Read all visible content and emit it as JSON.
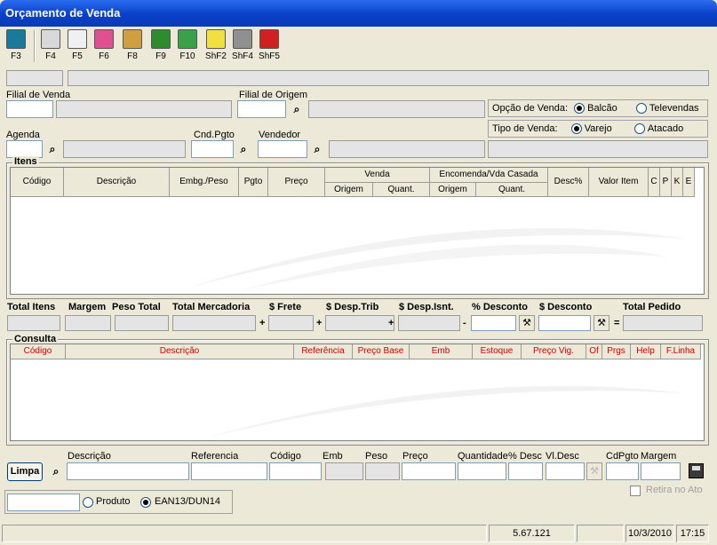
{
  "window": {
    "title": "Orçamento de Venda"
  },
  "toolbar": [
    {
      "key": "F3",
      "icon": "door-exit-icon",
      "color": "#1a7a9a"
    },
    {
      "key": "F4",
      "icon": "notepad-icon",
      "color": "#d8d8d8"
    },
    {
      "key": "F5",
      "icon": "documents-icon",
      "color": "#f0f0f0"
    },
    {
      "key": "F6",
      "icon": "eraser-icon",
      "color": "#e05090"
    },
    {
      "key": "F8",
      "icon": "hammer-icon",
      "color": "#d0a040"
    },
    {
      "key": "F9",
      "icon": "money-icon",
      "color": "#2e8b2e"
    },
    {
      "key": "F10",
      "icon": "chart-icon",
      "color": "#3aa04a"
    },
    {
      "key": "ShF2",
      "icon": "lightbulb-icon",
      "color": "#f0e040"
    },
    {
      "key": "ShF4",
      "icon": "trash-icon",
      "color": "#909090"
    },
    {
      "key": "ShF5",
      "icon": "telephone-icon",
      "color": "#d02020"
    }
  ],
  "header": {
    "filial_venda": "Filial de Venda",
    "filial_origem": "Filial de Origem",
    "agenda": "Agenda",
    "cnd_pgto": "Cnd.Pgto",
    "vendedor": "Vendedor",
    "opcao_venda": {
      "label": "Opção de Venda:",
      "opt1": "Balcão",
      "opt2": "Televendas",
      "selected": "Balcão"
    },
    "tipo_venda": {
      "label": "Tipo de Venda:",
      "opt1": "Varejo",
      "opt2": "Atacado",
      "selected": "Varejo"
    }
  },
  "itens": {
    "title": "Itens",
    "headers": {
      "codigo": "Código",
      "descricao": "Descrição",
      "embg": "Embg./Peso",
      "pgto": "Pgto",
      "preco": "Preço",
      "venda": "Venda",
      "encomenda": "Encomenda/Vda Casada",
      "origem": "Origem",
      "quant": "Quant.",
      "desc": "Desc%",
      "valor": "Valor Item",
      "c": "C",
      "p": "P",
      "k": "K",
      "e": "E"
    }
  },
  "totals": {
    "total_itens": "Total Itens",
    "margem": "Margem",
    "peso_total": "Peso Total",
    "total_mercadoria": "Total Mercadoria",
    "frete": "$ Frete",
    "desp_trib": "$ Desp.Trib",
    "desp_isnt": "$ Desp.Isnt.",
    "pct_desconto": "% Desconto",
    "desconto": "$ Desconto",
    "total_pedido": "Total Pedido"
  },
  "consulta": {
    "title": "Consulta",
    "headers": [
      "Código",
      "Descrição",
      "Referência",
      "Preço Base",
      "Emb",
      "Estoque",
      "Preço Vig.",
      "Of",
      "Prgs",
      "Help",
      "F.Linha"
    ]
  },
  "search": {
    "descricao": "Descrição",
    "referencia": "Referencia",
    "codigo": "Código",
    "emb": "Emb",
    "peso": "Peso",
    "preco": "Preço",
    "quantidade": "Quantidade",
    "pct_desc": "% Desc",
    "vl_desc": "Vl.Desc",
    "cdpgto": "CdPgto",
    "margem": "Margem",
    "limpa": "Limpa",
    "retira_no_ato": "Retira no Ato",
    "produto": "Produto",
    "ean": "EAN13/DUN14",
    "selected": "EAN13/DUN14"
  },
  "statusbar": {
    "version": "5.67.121",
    "date": "10/3/2010",
    "time": "17:15"
  }
}
